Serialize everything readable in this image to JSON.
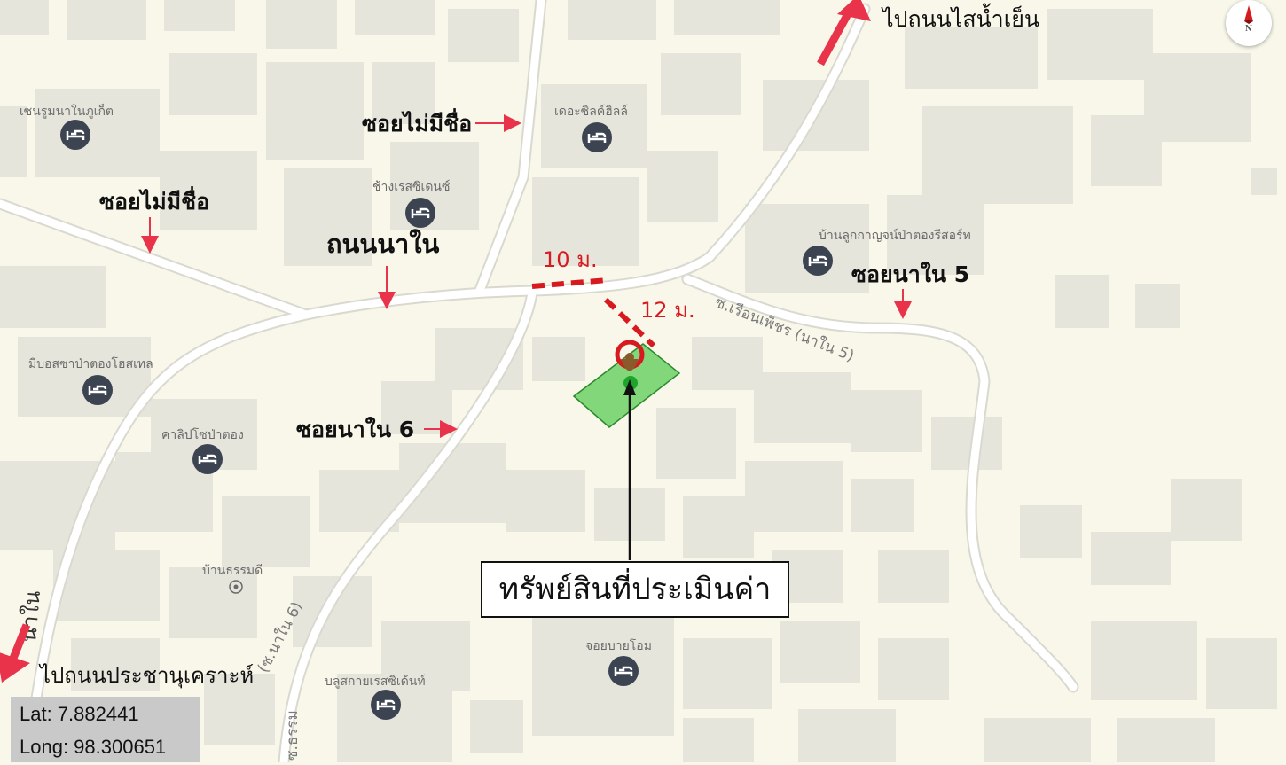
{
  "map": {
    "main_label": "ทรัพย์สินที่ประเมินค่า",
    "coordinates": {
      "lat_text": "Lat: 7.882441",
      "long_text": "Long: 98.300651"
    },
    "compass_letter": "N",
    "directions": {
      "to_sainamyen": "ไปถนนไสน้ำเย็น",
      "to_prachanukhro": "ไปถนนประชานุเคราะห์"
    },
    "road_annotations": {
      "naai_road": "ถนนนาใน",
      "soi_unnamed_1": "ซอยไม่มีชื่อ",
      "soi_unnamed_2": "ซอยไม่มีชื่อ",
      "soi_nanai_5": "ซอยนาใน 5",
      "soi_nanai_6": "ซอยนาใน 6"
    },
    "widths": {
      "road_width": "10 ม.",
      "soi_width": "12 ม."
    },
    "street_labels": {
      "ruean_phet": "ซ.เรือนเพ็ชร (นาใน 5)",
      "nanai_6": "(ซ.นาใน 6)",
      "left_edge": "นาใน",
      "bottom_edge": "ซ.ธรรม"
    },
    "pois": [
      {
        "name": "เซนรูมนาในภูเก็ต",
        "icon": "hotel-icon"
      },
      {
        "name": "เดอะซิลค์ฮิลล์",
        "icon": "hotel-icon"
      },
      {
        "name": "ช้างเรสซิเดนซ์",
        "icon": "hotel-icon"
      },
      {
        "name": "บ้านลูกกาญจน์ป่าตองรีสอร์ท",
        "icon": "hotel-icon"
      },
      {
        "name": "มีบอสซาป่าตองโฮสเทล",
        "icon": "hotel-icon"
      },
      {
        "name": "คาลิปโซป่าตอง",
        "icon": "hotel-icon"
      },
      {
        "name": "บ้านธรรมดี",
        "icon": "place-icon"
      },
      {
        "name": "จอยบายโอม",
        "icon": "hotel-icon"
      },
      {
        "name": "บลูสกายเรสซิเด้นท์",
        "icon": "hotel-icon"
      }
    ],
    "colors": {
      "background": "#f8f7ea",
      "building": "#e6e5dc",
      "arrow": "#e8334a",
      "property": "#6fd36a",
      "marker": "#d71920"
    }
  }
}
